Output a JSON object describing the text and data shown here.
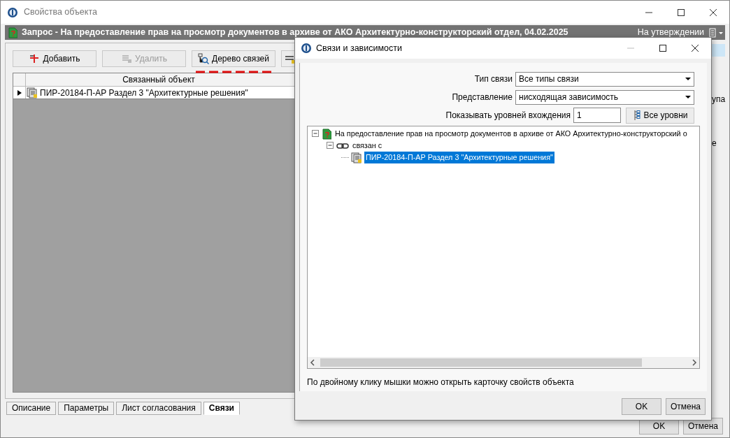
{
  "window": {
    "title": "Свойства объекта"
  },
  "document_bar": {
    "title": "Запрос - На предоставление прав на просмотр документов в архиве от АКО Архитектурно-конструкторский отдел, 04.02.2025",
    "status": "На утверждении"
  },
  "toolbar": [
    {
      "label": "Добавить",
      "kind": "add",
      "disabled": false
    },
    {
      "label": "Удалить",
      "kind": "delete",
      "disabled": true
    },
    {
      "label": "Дерево связей",
      "kind": "tree",
      "disabled": false,
      "highlighted": true
    }
  ],
  "grid": {
    "columns": [
      "Связанный объект"
    ],
    "rows": [
      {
        "cells": [
          "ПИР-20184-П-АР Раздел 3 \"Архитектурные решения\""
        ],
        "current": true
      }
    ]
  },
  "side_fragments": [
    "упа",
    "е"
  ],
  "tabs": [
    {
      "label": "Описание",
      "selected": false
    },
    {
      "label": "Параметры",
      "selected": false
    },
    {
      "label": "Лист согласования",
      "selected": false
    },
    {
      "label": "Связи",
      "selected": true
    }
  ],
  "buttons": [
    "OK",
    "Отмена"
  ],
  "dialog": {
    "title": "Связи и зависимости",
    "fields": [
      {
        "label": "Тип связи",
        "value": "Все типы связи"
      },
      {
        "label": "Представление",
        "value": "нисходящая зависимость"
      }
    ],
    "levels": {
      "label": "Показывать уровней вхождения",
      "value": "1",
      "button": "Все уровни"
    },
    "tree": [
      {
        "label": "На предоставление прав на просмотр документов в архиве от АКО Архитектурно-конструкторский о",
        "kind": "request",
        "expanded": true,
        "selected": false,
        "children": [
          {
            "label": "связан с",
            "kind": "link",
            "expanded": true,
            "selected": false,
            "children": [
              {
                "label": "ПИР-20184-П-АР Раздел 3 \"Архитектурные решения\"",
                "kind": "document",
                "selected": true
              }
            ]
          }
        ]
      }
    ],
    "hint": "По двойному клику мышки можно открыть карточку свойств объекта",
    "buttons": [
      "OK",
      "Отмена"
    ]
  }
}
